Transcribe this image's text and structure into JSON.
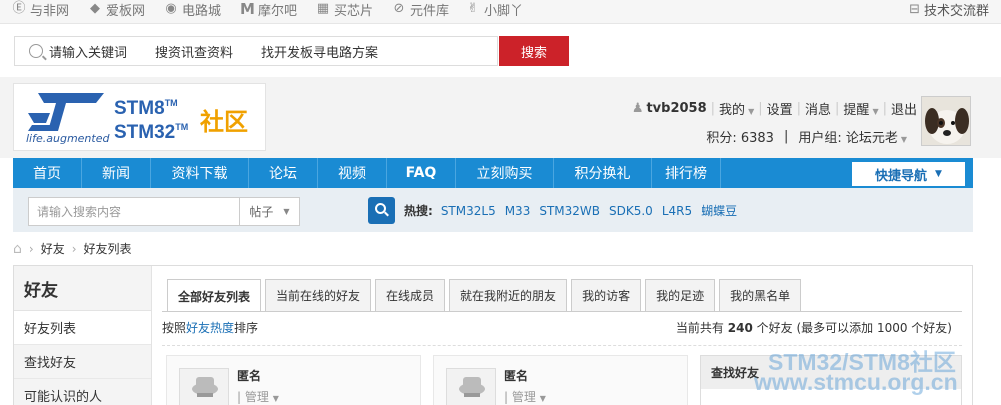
{
  "topbar": {
    "sites": [
      {
        "label": "与非网",
        "icon": "e-circle-icon"
      },
      {
        "label": "爱板网",
        "icon": "diamond-icon"
      },
      {
        "label": "电路城",
        "icon": "circuit-icon"
      },
      {
        "label": "摩尔吧",
        "icon": "m-letter-icon"
      },
      {
        "label": "买芯片",
        "icon": "chip-grid-icon"
      },
      {
        "label": "元件库",
        "icon": "component-icon"
      },
      {
        "label": "小脚丫",
        "icon": "footprint-icon"
      }
    ],
    "group_label": "技术交流群",
    "group_icon": "chat-group-icon"
  },
  "search": {
    "links": [
      "请输入关键词",
      "搜资讯查资料",
      "找开发板寻电路方案"
    ],
    "button": "搜索"
  },
  "header": {
    "logo_tagline": "life.augmented",
    "logo_stm8": "STM8",
    "logo_stm32": "STM32",
    "logo_tm": "TM",
    "logo_shequ": "社区",
    "username": "tvb2058",
    "menu_mine": "我的",
    "menu_settings": "设置",
    "menu_messages": "消息",
    "menu_remind": "提醒",
    "menu_logout": "退出",
    "points": "积分: 6383",
    "usergroup": "用户组: 论坛元老"
  },
  "nav": {
    "items": [
      "首页",
      "新闻",
      "资料下载",
      "论坛",
      "视频",
      "FAQ",
      "立刻购买",
      "积分换礼",
      "排行榜"
    ],
    "quick": "快捷导航"
  },
  "subsearch": {
    "placeholder": "请输入搜索内容",
    "select": "帖子",
    "hot_label": "热搜:",
    "hot": [
      "STM32L5",
      "M33",
      "STM32WB",
      "SDK5.0",
      "L4R5",
      "蝴蝶豆"
    ]
  },
  "breadcrumb": [
    "好友",
    "好友列表"
  ],
  "sidebar": {
    "title": "好友",
    "items": [
      "好友列表",
      "查找好友",
      "可能认识的人"
    ]
  },
  "tabs": [
    "全部好友列表",
    "当前在线的好友",
    "在线成员",
    "就在我附近的朋友",
    "我的访客",
    "我的足迹",
    "我的黑名单"
  ],
  "sort": {
    "prefix": "按照",
    "link": "好友热度",
    "suffix": "排序",
    "count_prefix": "当前共有",
    "count": "240",
    "count_suffix": "个好友 (最多可以添加 1000 个好友)"
  },
  "cards": [
    {
      "name": "匿名",
      "manage": "管理"
    },
    {
      "name": "匿名",
      "manage": "管理"
    }
  ],
  "find_friend": {
    "title": "查找好友"
  },
  "watermark": {
    "line1": "STM32/STM8社区",
    "line2": "www.stmcu.org.cn"
  },
  "colors": {
    "nav": "#1a8bd3",
    "search_button": "#cc2229",
    "link": "#1a6fb5",
    "brand_orange": "#f0a100"
  }
}
